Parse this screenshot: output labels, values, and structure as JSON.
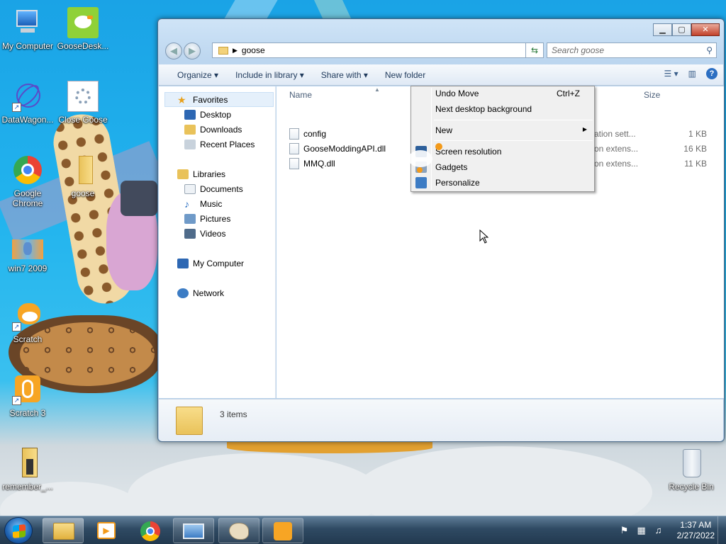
{
  "desktop": {
    "icons": [
      {
        "label": "My Computer",
        "icon": "computer-icon"
      },
      {
        "label": "GooseDesk...",
        "icon": "goose-icon"
      },
      {
        "label": "DataWagon...",
        "icon": "atom-icon"
      },
      {
        "label": "Close Goose",
        "icon": "gear-icon"
      },
      {
        "label": "Google Chrome",
        "icon": "chrome-icon"
      },
      {
        "label": "goose",
        "icon": "folder-icon"
      },
      {
        "label": "win7 2009",
        "icon": "image-icon"
      },
      {
        "label": "Scratch",
        "icon": "scratch-cat-icon"
      },
      {
        "label": "Scratch 3",
        "icon": "scratch3-icon"
      },
      {
        "label": "remember_...",
        "icon": "folder-icon"
      },
      {
        "label": "Recycle Bin",
        "icon": "recycle-bin-icon"
      }
    ]
  },
  "window": {
    "address": "goose",
    "search_placeholder": "Search goose",
    "toolbar": {
      "organize": "Organize ▾",
      "include_library": "Include in library ▾",
      "share_with": "Share with ▾",
      "new_folder": "New folder"
    },
    "nav": {
      "favorites": "Favorites",
      "desktop": "Desktop",
      "downloads": "Downloads",
      "recent": "Recent Places",
      "libraries": "Libraries",
      "documents": "Documents",
      "music": "Music",
      "pictures": "Pictures",
      "videos": "Videos",
      "computer": "My Computer",
      "network": "Network"
    },
    "columns": {
      "name": "Name",
      "size": "Size"
    },
    "files": [
      {
        "name": "config",
        "type": "ation sett...",
        "size": "1 KB"
      },
      {
        "name": "GooseModdingAPI.dll",
        "type": "on extens...",
        "size": "16 KB"
      },
      {
        "name": "MMQ.dll",
        "type": "on extens...",
        "size": "11 KB"
      }
    ],
    "status": "3 items"
  },
  "context_menu": {
    "undo": "Undo Move",
    "undo_shortcut": "Ctrl+Z",
    "next_bg": "Next desktop background",
    "new": "New",
    "screen_res": "Screen resolution",
    "gadgets": "Gadgets",
    "personalize": "Personalize"
  },
  "taskbar": {
    "time": "1:37 AM",
    "date": "2/27/2022"
  },
  "colors": {
    "desktop_blue": "#22b4ee",
    "taskbar": "#2f4a63",
    "window_frame": "#bcd6ef"
  }
}
